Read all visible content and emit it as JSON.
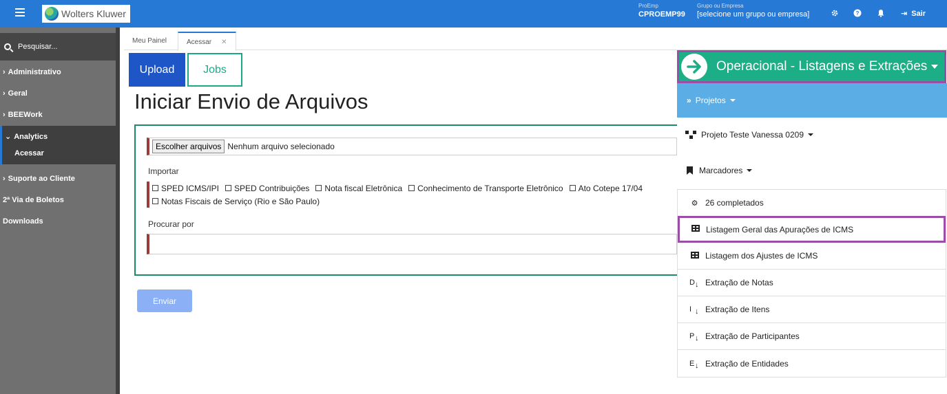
{
  "topbar": {
    "brand": "Wolters Kluwer",
    "proemp_label": "ProEmp",
    "proemp_value": "CPROEMP99",
    "grupo_label": "Grupo ou Empresa",
    "grupo_value": "[selecione um grupo ou empresa]",
    "sair": "Sair",
    "color": "#2779d6"
  },
  "sidebar": {
    "search_placeholder": "Pesquisar...",
    "items": [
      {
        "label": "Administrativo",
        "chevron": "›"
      },
      {
        "label": "Geral",
        "chevron": "›"
      },
      {
        "label": "BEEWork",
        "chevron": "›"
      }
    ],
    "analytics": {
      "label": "Analytics",
      "chevron": "⌄",
      "sub": "Acessar"
    },
    "items_after": [
      {
        "label": "Suporte ao Cliente",
        "chevron": "›"
      },
      {
        "label": "2ª Via de Boletos",
        "chevron": ""
      },
      {
        "label": "Downloads",
        "chevron": ""
      }
    ]
  },
  "tabs": [
    {
      "label": "Meu Painel"
    },
    {
      "label": "Acessar",
      "close": "✕"
    }
  ],
  "main": {
    "upload_label": "Upload",
    "jobs_label": "Jobs",
    "title": "Iniciar Envio de Arquivos",
    "file_button": "Escolher arquivos",
    "file_status": "Nenhum arquivo selecionado",
    "importar_label": "Importar",
    "checkboxes": [
      "SPED ICMS/IPI",
      "SPED Contribuições",
      "Nota fiscal Eletrônica",
      "Conhecimento de Transporte Eletrônico",
      "Ato Cotepe 17/04",
      "Notas Fiscais de Serviço (Rio e São Paulo)"
    ],
    "procurar_label": "Procurar por",
    "enviar_label": "Enviar"
  },
  "panel": {
    "header_title": "Operacional - Listagens e Extrações",
    "projetos_label": "Projetos",
    "projeto_atual": "Projeto Teste Vanessa 0209",
    "marcadores_label": "Marcadores",
    "items": [
      {
        "icon": "gear",
        "label": "26 completados"
      },
      {
        "icon": "table",
        "label": "Listagem Geral das Apurações de ICMS"
      },
      {
        "icon": "table",
        "label": "Listagem dos Ajustes de ICMS"
      },
      {
        "icon": "D",
        "label": "Extração de Notas"
      },
      {
        "icon": "I",
        "label": "Extração de Itens"
      },
      {
        "icon": "P",
        "label": "Extração de Participantes"
      },
      {
        "icon": "E",
        "label": "Extração de Entidades"
      }
    ],
    "colors": {
      "header": "#1cae87",
      "highlight": "#9b4ea8",
      "projetos": "#5aaee5"
    }
  }
}
